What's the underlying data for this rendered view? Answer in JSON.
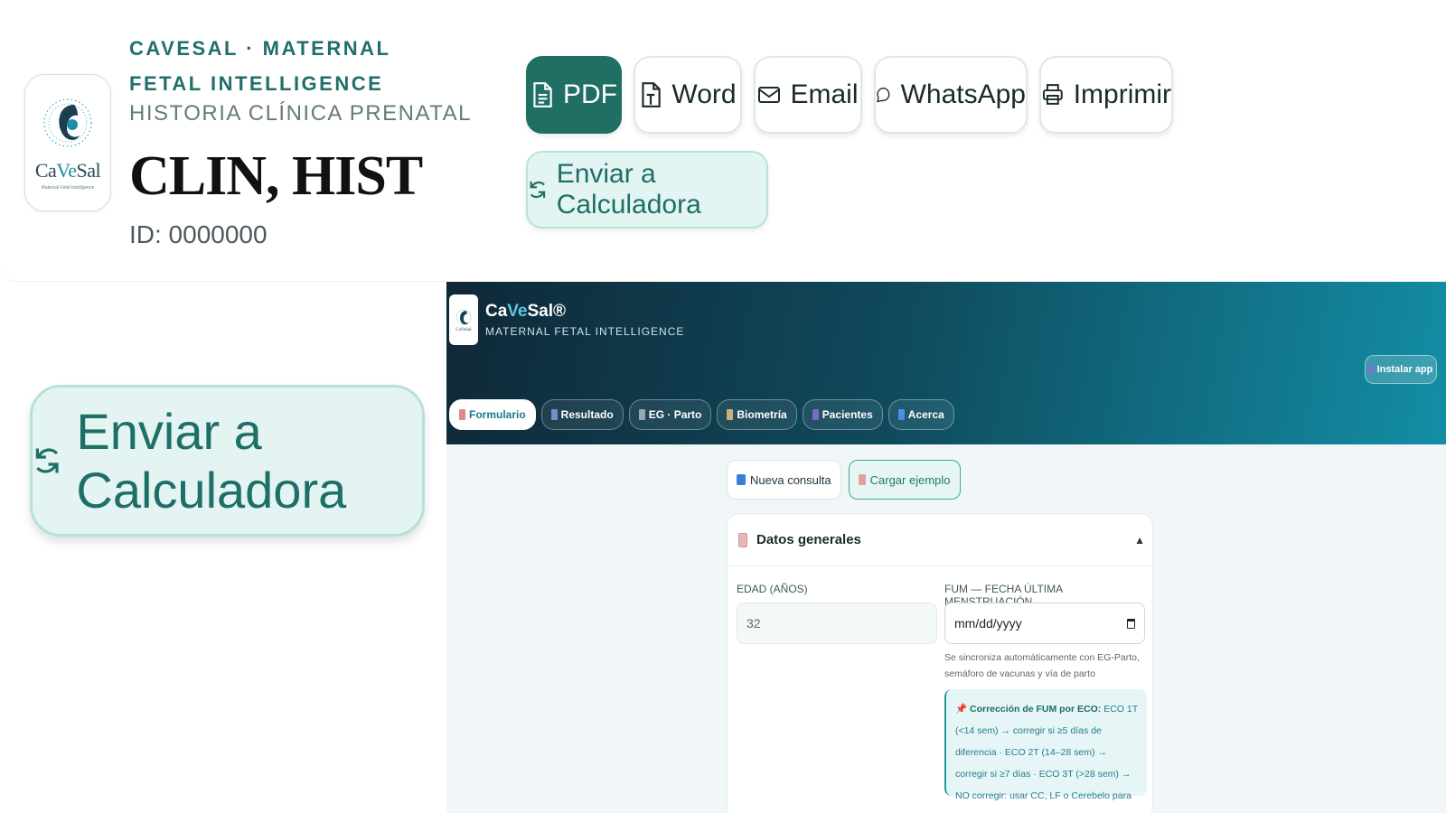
{
  "header": {
    "brand": "CAVESAL · MATERNAL FETAL INTELLIGENCE",
    "document_type": "HISTORIA CLÍNICA PRENATAL",
    "patient_name": "CLIN, HIST",
    "patient_id": "ID: 0000000",
    "logo_text": "CaVeSal",
    "logo_tagline": "Maternal Fetal Intelligence"
  },
  "export_buttons": {
    "pdf": "PDF",
    "word": "Word",
    "email": "Email",
    "whatsapp": "WhatsApp",
    "print": "Imprimir",
    "send_calc": "Enviar a Calculadora"
  },
  "zoom_callout": {
    "label": "Enviar a Calculadora"
  },
  "app": {
    "title_pre": "Ca",
    "title_ve": "Ve",
    "title_post": "Sal®",
    "subtitle": "MATERNAL FETAL INTELLIGENCE",
    "install": "Instalar app",
    "tabs": [
      {
        "label": "Formulario",
        "color": "#e08a8a",
        "active": true
      },
      {
        "label": "Resultado",
        "color": "#7a8cc8",
        "active": false
      },
      {
        "label": "EG · Parto",
        "color": "#9aa6b8",
        "active": false
      },
      {
        "label": "Biometría",
        "color": "#c8b07a",
        "active": false
      },
      {
        "label": "Pacientes",
        "color": "#7a6ac8",
        "active": false
      },
      {
        "label": "Acerca",
        "color": "#4a90e2",
        "active": false
      }
    ],
    "actions": {
      "new": "Nueva consulta",
      "example": "Cargar ejemplo"
    },
    "section": {
      "title": "Datos generales",
      "age_label": "EDAD (AÑOS)",
      "age_value": "32",
      "fum_label": "FUM — FECHA ÚLTIMA MENSTRUACIÓN",
      "fum_placeholder": "mm/dd/yyyy",
      "fum_help": "Se sincroniza automáticamente con EG-Parto, semáforo de vacunas y vía de parto",
      "note_title": "Corrección de FUM por ECO:",
      "note_body": "ECO 1T (<14 sem) → corregir si ≥5 días de diferencia · ECO 2T (14–28 sem) → corregir si ≥7 días · ECO 3T (>28 sem) → NO corregir: usar CC, LF o Cerebelo para EG."
    }
  }
}
